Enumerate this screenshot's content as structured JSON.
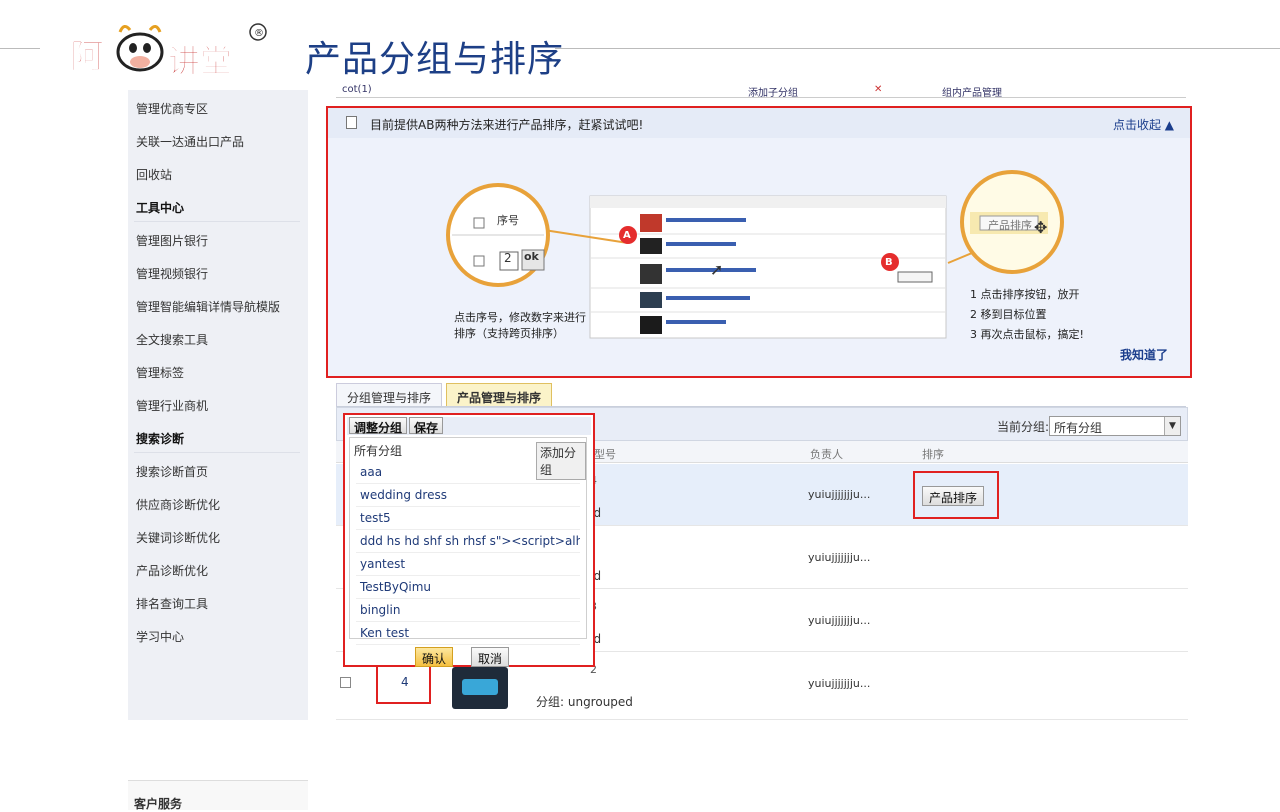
{
  "slide": {
    "title": "产品分组与排序",
    "logo_text": "阿",
    "logo_text2": "讲堂"
  },
  "sidebar": {
    "items": [
      {
        "label": "管理优商专区",
        "head": false
      },
      {
        "label": "关联一达通出口产品",
        "head": false
      },
      {
        "label": "回收站",
        "head": false
      },
      {
        "label": "工具中心",
        "head": true
      },
      {
        "label": "管理图片银行",
        "head": false
      },
      {
        "label": "管理视频银行",
        "head": false
      },
      {
        "label": "管理智能编辑详情导航模版",
        "head": false
      },
      {
        "label": "全文搜索工具",
        "head": false
      },
      {
        "label": "管理标签",
        "head": false
      },
      {
        "label": "管理行业商机",
        "head": false
      },
      {
        "label": "搜索诊断",
        "head": true
      },
      {
        "label": "搜索诊断首页",
        "head": false
      },
      {
        "label": "供应商诊断优化",
        "head": false
      },
      {
        "label": "关键词诊断优化",
        "head": false
      },
      {
        "label": "产品诊断优化",
        "head": false
      },
      {
        "label": "排名查询工具",
        "head": false
      },
      {
        "label": "学习中心",
        "head": false
      }
    ],
    "bottom": "客户服务"
  },
  "top_strip": {
    "left": "cot(1)",
    "mid": "添加子分组",
    "right": "组内产品管理"
  },
  "tip": {
    "text": "目前提供AB两种方法来进行产品排序，赶紧试试吧!",
    "collapse": "点击收起 ▲",
    "hint": "点击序号，修改数字来进行排序（支持跨页排序）",
    "seq_label": "序号",
    "seq_value": "2",
    "ok": "ok",
    "sort_btn": "产品排序",
    "marker_a": "A",
    "marker_b": "B",
    "steps": [
      "1 点击排序按钮，放开",
      "2 移到目标位置",
      "3 再次点击鼠标，搞定!"
    ],
    "got_it": "我知道了"
  },
  "tabs": [
    "分组管理与排序",
    "产品管理与排序"
  ],
  "toolbar": {
    "adjust": "调整分组",
    "save": "保存",
    "current_label": "当前分组:",
    "current_value": "所有分组"
  },
  "table": {
    "headers": {
      "model": "型号",
      "owner": "负责人",
      "sort": "排序"
    },
    "rows": [
      {
        "num": "4",
        "owner": "yuiujjjjjjju...",
        "group": "ungrouped"
      },
      {
        "num": "",
        "owner": "yuiujjjjjjju...",
        "group": "ungrouped"
      },
      {
        "num": "3",
        "owner": "yuiujjjjjjju...",
        "group": "ungrouped"
      },
      {
        "num": "2",
        "owner": "yuiujjjjjjju...",
        "group": "分组: ungrouped"
      }
    ],
    "sort_button": "产品排序",
    "seq_input": "4"
  },
  "dropdown": {
    "all": "所有分组",
    "add": "添加分组",
    "items": [
      "aaa",
      "wedding dress",
      "test5",
      "ddd hs hd shf sh rhsf s\"><script>alhfrs...",
      "yantest",
      "TestByQimu",
      "binglin",
      "Ken test"
    ],
    "confirm": "确认",
    "cancel": "取消"
  }
}
